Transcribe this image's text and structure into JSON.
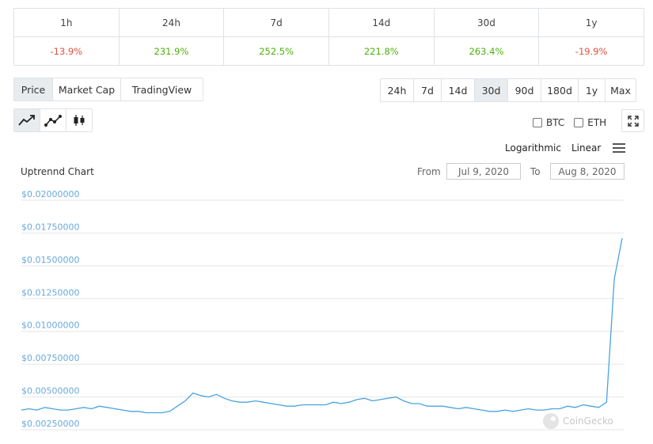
{
  "performance": {
    "headers": [
      "1h",
      "24h",
      "7d",
      "14d",
      "30d",
      "1y"
    ],
    "values": [
      "-13.9%",
      "231.9%",
      "252.5%",
      "221.8%",
      "263.4%",
      "-19.9%"
    ],
    "signs": [
      "neg",
      "pos",
      "pos",
      "pos",
      "pos",
      "neg"
    ]
  },
  "view_tabs": [
    "Price",
    "Market Cap",
    "TradingView"
  ],
  "active_view": "Price",
  "ranges": [
    "24h",
    "7d",
    "14d",
    "30d",
    "90d",
    "180d",
    "1y",
    "Max"
  ],
  "active_range": "30d",
  "chart_types": [
    "line-chart-icon",
    "line-points-icon",
    "candlestick-icon"
  ],
  "compare": {
    "btc": "BTC",
    "eth": "ETH"
  },
  "scale": {
    "log": "Logarithmic",
    "linear": "Linear"
  },
  "chart_title": "Uptrennd Chart",
  "range_picker": {
    "from_label": "From",
    "from_value": "Jul 9, 2020",
    "to_label": "To",
    "to_value": "Aug 8, 2020"
  },
  "watermark": "CoinGecko",
  "colors": {
    "line": "#4aa3df",
    "negative": "#e15241",
    "positive": "#4eaf0a"
  },
  "chart_data": {
    "type": "line",
    "title": "Uptrennd Chart",
    "y_tick_labels": [
      "$0.02000000",
      "$0.01750000",
      "$0.01500000",
      "$0.01250000",
      "$0.01000000",
      "$0.00750000",
      "$0.00500000",
      "$0.00250000"
    ],
    "ylim": [
      0.0025,
      0.02
    ],
    "x_range": [
      "Jul 9, 2020",
      "Aug 8, 2020"
    ],
    "series": [
      {
        "values": [
          0.004,
          0.0041,
          0.004,
          0.0042,
          0.0041,
          0.004,
          0.004,
          0.0041,
          0.0042,
          0.0041,
          0.0043,
          0.0042,
          0.0041,
          0.004,
          0.0039,
          0.0039,
          0.0038,
          0.0038,
          0.0038,
          0.0039,
          0.0043,
          0.0047,
          0.0053,
          0.0051,
          0.005,
          0.0052,
          0.0049,
          0.0047,
          0.0046,
          0.0046,
          0.0047,
          0.0046,
          0.0045,
          0.0044,
          0.0043,
          0.0043,
          0.0044,
          0.0044,
          0.0044,
          0.0044,
          0.0046,
          0.0045,
          0.0046,
          0.0048,
          0.0049,
          0.0047,
          0.0048,
          0.0049,
          0.005,
          0.0047,
          0.0045,
          0.0045,
          0.0043,
          0.0043,
          0.0043,
          0.0042,
          0.0041,
          0.0042,
          0.0041,
          0.004,
          0.0039,
          0.0039,
          0.004,
          0.0039,
          0.004,
          0.0041,
          0.004,
          0.004,
          0.0041,
          0.0041,
          0.0043,
          0.0042,
          0.0044,
          0.0043,
          0.0042,
          0.0046,
          0.014,
          0.0171
        ]
      }
    ]
  }
}
